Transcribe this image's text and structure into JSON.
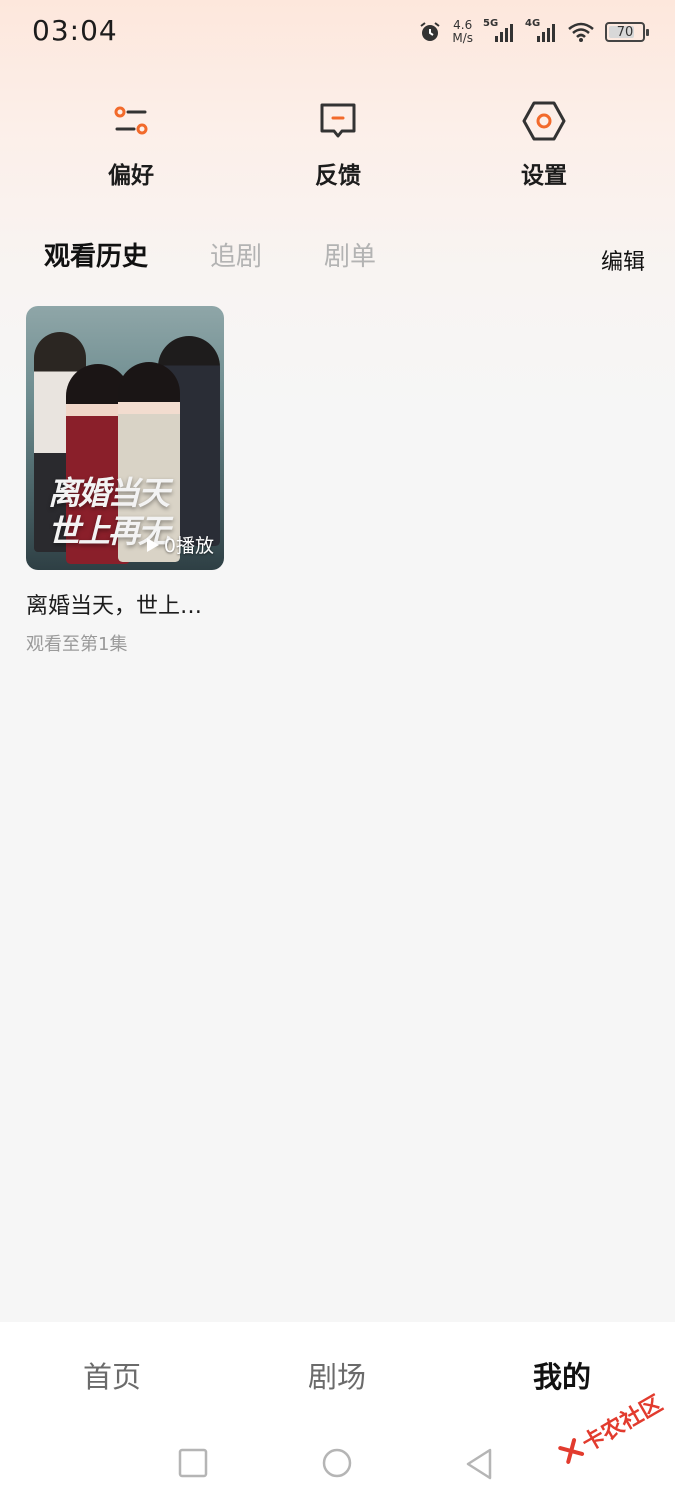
{
  "status_bar": {
    "time": "03:04",
    "net_speed_value": "4.6",
    "net_speed_unit": "M/s",
    "signal1_label": "5G",
    "signal2_label": "4G",
    "battery": "70"
  },
  "quick_actions": [
    {
      "label": "偏好",
      "icon": "preference-icon"
    },
    {
      "label": "反馈",
      "icon": "feedback-icon"
    },
    {
      "label": "设置",
      "icon": "settings-icon"
    }
  ],
  "accent_color": "#f26a2b",
  "tabs": [
    {
      "label": "观看历史",
      "active": true
    },
    {
      "label": "追剧",
      "active": false
    },
    {
      "label": "剧单",
      "active": false
    }
  ],
  "edit_label": "编辑",
  "history": [
    {
      "poster_title_line1": "离婚当天",
      "poster_title_line2": "世上再无",
      "play_count": "0播放",
      "title": "离婚当天，世上…",
      "progress": "观看至第1集"
    }
  ],
  "bottom_nav": [
    {
      "label": "首页",
      "active": false
    },
    {
      "label": "剧场",
      "active": false
    },
    {
      "label": "我的",
      "active": true
    }
  ],
  "watermark": "卡农社区"
}
